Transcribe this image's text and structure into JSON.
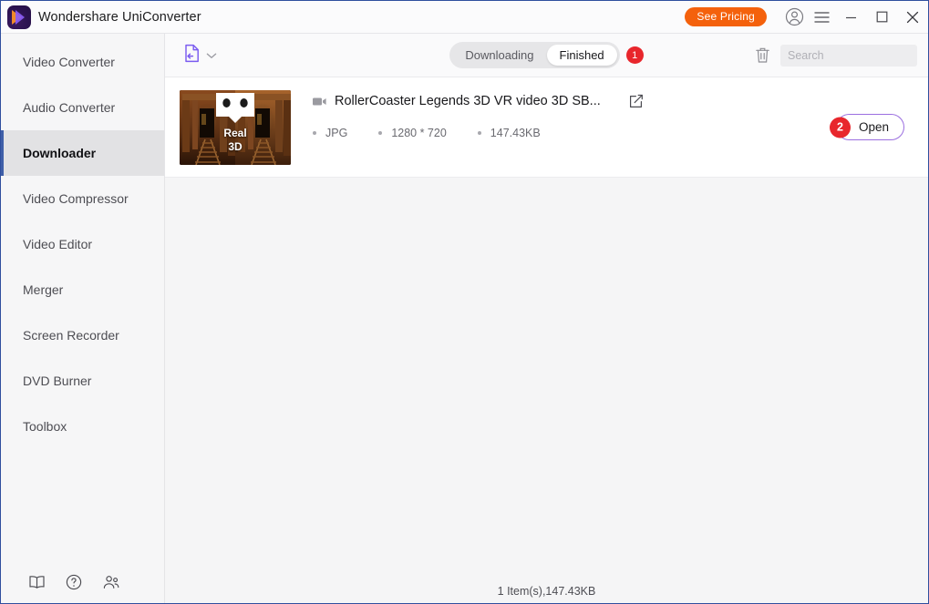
{
  "titlebar": {
    "app_title": "Wondershare UniConverter",
    "pricing_label": "See Pricing",
    "logo_name": "wondershare-logo",
    "account_icon": "account-avatar-icon",
    "menu_icon": "hamburger-menu-icon",
    "minimize_icon": "minimize-icon",
    "maximize_icon": "maximize-icon",
    "close_icon": "close-icon"
  },
  "sidebar": {
    "items": [
      {
        "label": "Video Converter",
        "active": false
      },
      {
        "label": "Audio Converter",
        "active": false
      },
      {
        "label": "Downloader",
        "active": true
      },
      {
        "label": "Video Compressor",
        "active": false
      },
      {
        "label": "Video Editor",
        "active": false
      },
      {
        "label": "Merger",
        "active": false
      },
      {
        "label": "Screen Recorder",
        "active": false
      },
      {
        "label": "DVD Burner",
        "active": false
      },
      {
        "label": "Toolbox",
        "active": false
      }
    ],
    "bottom_icons": [
      "book-icon",
      "help-icon",
      "community-icon"
    ]
  },
  "toolbar": {
    "import_icon": "import-file-icon",
    "dropdown_icon": "chevron-down-icon",
    "tabs": [
      {
        "label": "Downloading",
        "active": false
      },
      {
        "label": "Finished",
        "active": true
      }
    ],
    "badge_count": "1",
    "trash_icon": "trash-icon",
    "search_placeholder": "Search",
    "search_value": ""
  },
  "file": {
    "title": "RollerCoaster Legends 3D VR video 3D SB...",
    "video_icon": "video-camera-icon",
    "edit_icon": "edit-icon",
    "thumbnail_overlay_line1": "Real",
    "thumbnail_overlay_line2": "3D",
    "meta": [
      {
        "label": "JPG"
      },
      {
        "label": "1280 * 720"
      },
      {
        "label": "147.43KB"
      }
    ],
    "open_label": "Open",
    "step_badge": "2"
  },
  "statusbar": {
    "text": "1 Item(s),147.43KB"
  },
  "colors": {
    "accent_purple": "#8b5cf6",
    "open_border": "#9b6fe0",
    "pricing_orange": "#f4610c",
    "badge_red": "#e8262c",
    "window_border": "#2f4f9e"
  }
}
